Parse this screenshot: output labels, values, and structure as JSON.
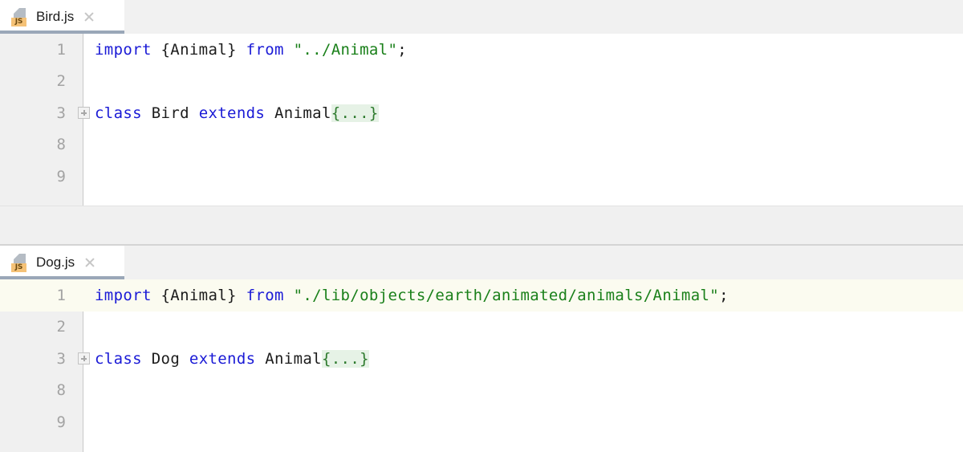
{
  "editors": [
    {
      "id": "bird",
      "tab": {
        "label": "Bird.js",
        "icon": "js-file-icon",
        "badge": "JS",
        "close": "close-icon",
        "active": true
      },
      "lines": [
        {
          "number": "1",
          "fold": false,
          "highlight": false,
          "tokens": [
            {
              "type": "kw",
              "text": "import"
            },
            {
              "type": "pln",
              "text": " {Animal} "
            },
            {
              "type": "kw",
              "text": "from"
            },
            {
              "type": "pln",
              "text": " "
            },
            {
              "type": "str",
              "text": "\"../Animal\""
            },
            {
              "type": "pln",
              "text": ";"
            }
          ]
        },
        {
          "number": "2",
          "fold": false,
          "highlight": false,
          "tokens": []
        },
        {
          "number": "3",
          "fold": true,
          "highlight": false,
          "tokens": [
            {
              "type": "kw",
              "text": "class"
            },
            {
              "type": "pln",
              "text": " Bird "
            },
            {
              "type": "kw",
              "text": "extends"
            },
            {
              "type": "pln",
              "text": " Animal"
            },
            {
              "type": "fold",
              "text": "{...}"
            }
          ]
        },
        {
          "number": "8",
          "fold": false,
          "highlight": false,
          "tokens": []
        },
        {
          "number": "9",
          "fold": false,
          "highlight": false,
          "tokens": []
        }
      ]
    },
    {
      "id": "dog",
      "tab": {
        "label": "Dog.js",
        "icon": "js-file-icon",
        "badge": "JS",
        "close": "close-icon",
        "active": true
      },
      "lines": [
        {
          "number": "1",
          "fold": false,
          "highlight": true,
          "tokens": [
            {
              "type": "kw",
              "text": "import"
            },
            {
              "type": "pln",
              "text": " {Animal} "
            },
            {
              "type": "kw",
              "text": "from"
            },
            {
              "type": "pln",
              "text": " "
            },
            {
              "type": "str",
              "text": "\"./lib/objects/earth/animated/animals/Animal\""
            },
            {
              "type": "pln",
              "text": ";"
            }
          ]
        },
        {
          "number": "2",
          "fold": false,
          "highlight": false,
          "tokens": []
        },
        {
          "number": "3",
          "fold": true,
          "highlight": false,
          "tokens": [
            {
              "type": "kw",
              "text": "class"
            },
            {
              "type": "pln",
              "text": " Dog "
            },
            {
              "type": "kw",
              "text": "extends"
            },
            {
              "type": "pln",
              "text": " Animal"
            },
            {
              "type": "fold",
              "text": "{...}"
            }
          ]
        },
        {
          "number": "8",
          "fold": false,
          "highlight": false,
          "tokens": []
        },
        {
          "number": "9",
          "fold": false,
          "highlight": false,
          "tokens": []
        }
      ]
    }
  ],
  "colors": {
    "keyword": "#1a1ad6",
    "string": "#1a801a",
    "plain": "#1c1c1c",
    "fold_background": "#e6f2e6",
    "fold_text": "#2d7a2d",
    "current_line": "#fbfbf0",
    "gutter": "#f0f0f0",
    "tab_underline": "#9aa7b8",
    "js_badge": "#f5c277"
  }
}
